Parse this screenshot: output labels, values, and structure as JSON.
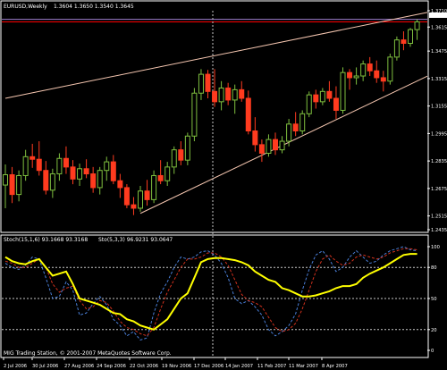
{
  "window": {
    "symbol_title": "EURUSD,Weekly",
    "ohlc_text": "1.3604 1.3650 1.3540 1.3645"
  },
  "indicator": {
    "title_stoch1": "Stoch(15,1,6) 93.1668 93.3168",
    "title_stoch2": "Sto(5,3,3) 96.9231 93.0647"
  },
  "footer": {
    "copyright": "MIG Trading Station, © 2001-2007 MetaQuotes Software Corp."
  },
  "colors": {
    "background": "#000000",
    "bull": "#7fbf3f",
    "bear": "#ff3b1f",
    "trendline": "#f5c6b0",
    "level_red": "#ff0000",
    "level_purple": "#9f7fd0",
    "axis": "#ffffff",
    "dotted": "#c8c8c8",
    "stoch_main": "#ffff00",
    "stoch_blue": "#4a7fd8",
    "stoch_red": "#d0301c"
  },
  "chart_data": {
    "type": "candlestick",
    "price_axis_ticks": [
      "1.3710",
      "1.3615",
      "1.3475",
      "1.3315",
      "1.3155",
      "1.2995",
      "1.2835",
      "1.2675",
      "1.2515",
      "1.2435"
    ],
    "stoch_axis_ticks": [
      "100",
      "80",
      "50",
      "20",
      "0"
    ],
    "time_axis_ticks": [
      "2 Jul 2006",
      "30 Jul 2006",
      "27 Aug 2006",
      "24 Sep 2006",
      "22 Oct 2006",
      "19 Nov 2006",
      "17 Dec 2006",
      "14 Jan 2007",
      "11 Feb 2007",
      "11 Mar 2007",
      "8 Apr 2007"
    ],
    "ylim": [
      1.2435,
      1.371
    ],
    "candles": [
      [
        1.2695,
        1.2815,
        1.256,
        1.2755
      ],
      [
        1.2755,
        1.28,
        1.259,
        1.264
      ],
      [
        1.264,
        1.278,
        1.26,
        1.275
      ],
      [
        1.275,
        1.29,
        1.272,
        1.286
      ],
      [
        1.286,
        1.2935,
        1.2795,
        1.2845
      ],
      [
        1.2845,
        1.295,
        1.275,
        1.278
      ],
      [
        1.278,
        1.2835,
        1.264,
        1.2665
      ],
      [
        1.2665,
        1.279,
        1.262,
        1.276
      ],
      [
        1.276,
        1.288,
        1.272,
        1.285
      ],
      [
        1.285,
        1.292,
        1.276,
        1.28
      ],
      [
        1.28,
        1.284,
        1.27,
        1.273
      ],
      [
        1.273,
        1.282,
        1.269,
        1.279
      ],
      [
        1.279,
        1.2845,
        1.2735,
        1.276
      ],
      [
        1.276,
        1.28,
        1.265,
        1.268
      ],
      [
        1.268,
        1.28,
        1.264,
        1.278
      ],
      [
        1.278,
        1.286,
        1.272,
        1.283
      ],
      [
        1.283,
        1.287,
        1.27,
        1.272
      ],
      [
        1.272,
        1.276,
        1.262,
        1.268
      ],
      [
        1.268,
        1.27,
        1.256,
        1.258
      ],
      [
        1.258,
        1.2625,
        1.252,
        1.256
      ],
      [
        1.256,
        1.269,
        1.254,
        1.266
      ],
      [
        1.266,
        1.2725,
        1.2575,
        1.261
      ],
      [
        1.261,
        1.278,
        1.259,
        1.275
      ],
      [
        1.275,
        1.284,
        1.27,
        1.272
      ],
      [
        1.272,
        1.283,
        1.269,
        1.28
      ],
      [
        1.28,
        1.292,
        1.276,
        1.29
      ],
      [
        1.29,
        1.295,
        1.281,
        1.284
      ],
      [
        1.284,
        1.3,
        1.281,
        1.298
      ],
      [
        1.298,
        1.326,
        1.295,
        1.323
      ],
      [
        1.323,
        1.337,
        1.319,
        1.334
      ],
      [
        1.334,
        1.3365,
        1.32,
        1.324
      ],
      [
        1.324,
        1.337,
        1.315,
        1.318
      ],
      [
        1.318,
        1.33,
        1.313,
        1.326
      ],
      [
        1.326,
        1.329,
        1.316,
        1.319
      ],
      [
        1.319,
        1.328,
        1.311,
        1.325
      ],
      [
        1.325,
        1.33,
        1.318,
        1.32
      ],
      [
        1.32,
        1.3245,
        1.299,
        1.301
      ],
      [
        1.301,
        1.309,
        1.289,
        1.293
      ],
      [
        1.293,
        1.296,
        1.283,
        1.288
      ],
      [
        1.288,
        1.299,
        1.286,
        1.296
      ],
      [
        1.296,
        1.3,
        1.287,
        1.29
      ],
      [
        1.29,
        1.298,
        1.288,
        1.295
      ],
      [
        1.295,
        1.308,
        1.292,
        1.305
      ],
      [
        1.305,
        1.312,
        1.298,
        1.301
      ],
      [
        1.301,
        1.313,
        1.299,
        1.311
      ],
      [
        1.311,
        1.324,
        1.309,
        1.322
      ],
      [
        1.322,
        1.325,
        1.314,
        1.318
      ],
      [
        1.318,
        1.326,
        1.316,
        1.324
      ],
      [
        1.324,
        1.33,
        1.318,
        1.32
      ],
      [
        1.32,
        1.327,
        1.308,
        1.313
      ],
      [
        1.313,
        1.338,
        1.311,
        1.335
      ],
      [
        1.335,
        1.337,
        1.325,
        1.332
      ],
      [
        1.332,
        1.338,
        1.328,
        1.333
      ],
      [
        1.333,
        1.342,
        1.33,
        1.34
      ],
      [
        1.34,
        1.344,
        1.333,
        1.336
      ],
      [
        1.336,
        1.342,
        1.329,
        1.332
      ],
      [
        1.332,
        1.336,
        1.324,
        1.33
      ],
      [
        1.33,
        1.346,
        1.328,
        1.344
      ],
      [
        1.344,
        1.356,
        1.342,
        1.354
      ],
      [
        1.354,
        1.359,
        1.348,
        1.352
      ],
      [
        1.352,
        1.361,
        1.35,
        1.36
      ],
      [
        1.36,
        1.366,
        1.354,
        1.3645
      ]
    ],
    "stoch_main": [
      90,
      86,
      84,
      83,
      86,
      88,
      80,
      72,
      74,
      76,
      64,
      50,
      48,
      46,
      44,
      40,
      36,
      35,
      30,
      28,
      24,
      22,
      20,
      25,
      30,
      40,
      50,
      55,
      70,
      85,
      88,
      89,
      89,
      88,
      87,
      85,
      82,
      76,
      72,
      68,
      66,
      60,
      58,
      55,
      52,
      52,
      53,
      55,
      57,
      60,
      62,
      62,
      64,
      70,
      74,
      77,
      80,
      84,
      88,
      92,
      93,
      93
    ],
    "stoch_blue": [
      84,
      80,
      78,
      82,
      90,
      88,
      70,
      50,
      52,
      66,
      58,
      34,
      36,
      45,
      52,
      44,
      30,
      24,
      14,
      18,
      10,
      12,
      36,
      55,
      66,
      80,
      90,
      88,
      90,
      95,
      96,
      92,
      84,
      70,
      50,
      45,
      48,
      42,
      34,
      20,
      14,
      18,
      24,
      35,
      58,
      78,
      92,
      96,
      88,
      76,
      80,
      90,
      96,
      90,
      84,
      86,
      92,
      96,
      98,
      100,
      97,
      96
    ],
    "stoch_red": [
      86,
      84,
      80,
      80,
      84,
      88,
      80,
      64,
      56,
      60,
      62,
      48,
      40,
      42,
      48,
      46,
      38,
      28,
      22,
      20,
      16,
      14,
      22,
      40,
      56,
      68,
      80,
      88,
      88,
      90,
      94,
      94,
      90,
      82,
      68,
      54,
      48,
      46,
      42,
      32,
      22,
      18,
      20,
      26,
      40,
      58,
      76,
      88,
      92,
      86,
      82,
      84,
      90,
      92,
      90,
      88,
      90,
      94,
      96,
      98,
      98,
      97
    ],
    "trend_upper": {
      "start": [
        0,
        1.32
      ],
      "end": [
        70,
        1.376
      ]
    },
    "trend_lower": {
      "start": [
        20,
        1.253
      ],
      "end": [
        70,
        1.347
      ]
    },
    "level_red": 1.3645,
    "level_purple": 1.366,
    "stoch_levels": [
      80,
      50,
      20
    ],
    "vline_index": 40
  }
}
